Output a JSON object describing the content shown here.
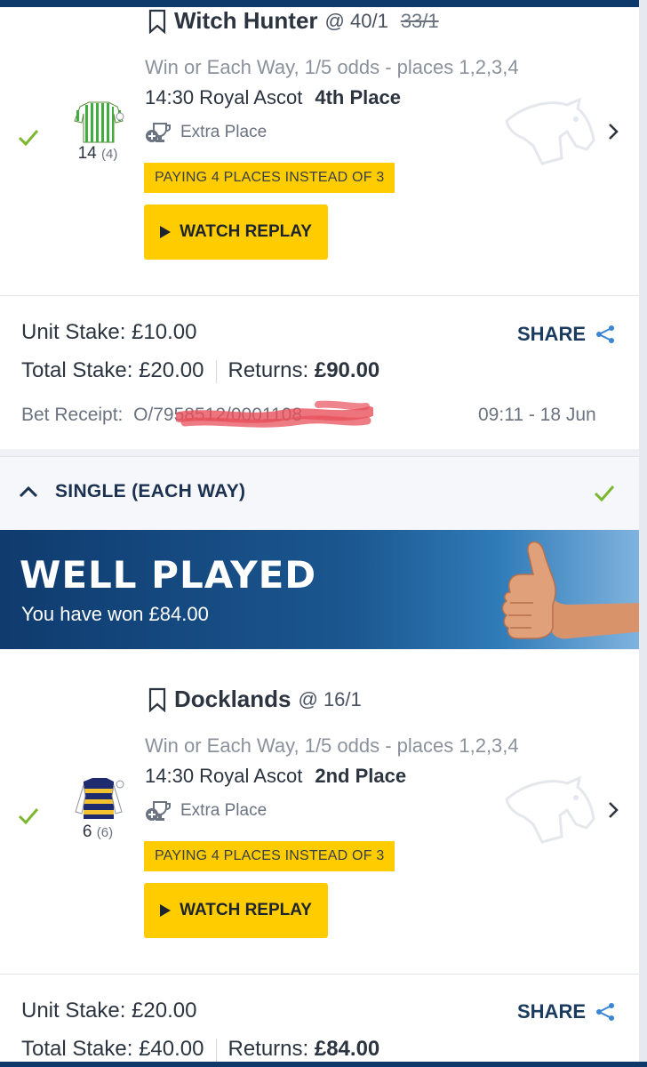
{
  "bet1": {
    "horse_name": "Witch Hunter",
    "odds": "@ 40/1",
    "odds_previous": "33/1",
    "market": "Win or Each Way, 1/5 odds - places 1,2,3,4",
    "race_time_course": "14:30 Royal Ascot",
    "finish_position": "4th Place",
    "extra_place_label": "Extra Place",
    "badge": "PAYING 4 PLACES INSTEAD OF 3",
    "replay_label": "WATCH REPLAY",
    "cloth_number": "14",
    "draw": "(4)",
    "unit_stake": "Unit Stake: £10.00",
    "total_stake": "Total Stake: £20.00",
    "returns_label": "Returns:",
    "returns_value": "£90.00",
    "share_label": "SHARE",
    "receipt_label": "Bet Receipt:",
    "receipt_number": "O/7958512/0001108",
    "receipt_time": "09:11 - 18 Jun"
  },
  "section": {
    "title": "SINGLE (EACH WAY)"
  },
  "banner": {
    "title": "WELL PLAYED",
    "subtitle": "You have won £84.00"
  },
  "bet2": {
    "horse_name": "Docklands",
    "odds": "@ 16/1",
    "market": "Win or Each Way, 1/5 odds - places 1,2,3,4",
    "race_time_course": "14:30 Royal Ascot",
    "finish_position": "2nd Place",
    "extra_place_label": "Extra Place",
    "badge": "PAYING 4 PLACES INSTEAD OF 3",
    "replay_label": "WATCH REPLAY",
    "cloth_number": "6",
    "draw": "(6)",
    "unit_stake": "Unit Stake: £20.00",
    "total_stake": "Total Stake: £40.00",
    "returns_label": "Returns:",
    "returns_value": "£84.00",
    "share_label": "SHARE"
  },
  "colors": {
    "accent_yellow": "#ffcc00",
    "navy": "#0e3a6b",
    "check_green": "#7cb82f"
  }
}
